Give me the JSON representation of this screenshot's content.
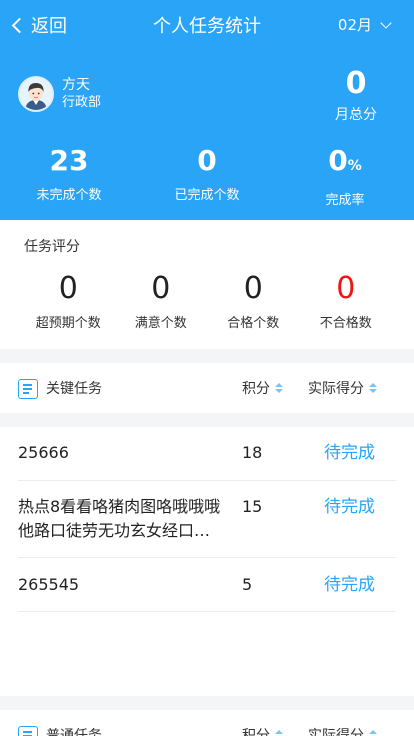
{
  "nav": {
    "back_label": "返回",
    "title": "个人任务统计",
    "month": "02月"
  },
  "profile": {
    "name": "方天",
    "department": "行政部"
  },
  "month_score": {
    "value": "0",
    "label": "月总分"
  },
  "stats": [
    {
      "value": "23",
      "unit": "",
      "label": "未完成个数"
    },
    {
      "value": "0",
      "unit": "",
      "label": "已完成个数"
    },
    {
      "value": "0",
      "unit": "%",
      "label": "完成率"
    }
  ],
  "evaluation": {
    "heading": "任务评分",
    "items": [
      {
        "value": "0",
        "label": "超预期个数"
      },
      {
        "value": "0",
        "label": "满意个数"
      },
      {
        "value": "0",
        "label": "合格个数"
      },
      {
        "value": "0",
        "label": "不合格数"
      }
    ]
  },
  "key_tasks": {
    "title": "关键任务",
    "col_score": "积分",
    "col_actual": "实际得分",
    "rows": [
      {
        "name_line1": "25666",
        "name_line2": "",
        "score": "18",
        "status": "待完成"
      },
      {
        "name_line1": "热点8看看咯猪肉图咯哦哦哦",
        "name_line2": "他路口徒劳无功玄女经口…",
        "score": "15",
        "status": "待完成"
      },
      {
        "name_line1": "265545",
        "name_line2": "",
        "score": "5",
        "status": "待完成"
      }
    ]
  },
  "normal_tasks": {
    "title": "普通任务",
    "col_score": "积分",
    "col_actual": "实际得分"
  },
  "colors": {
    "primary": "#2aa4f6",
    "danger": "#f01414"
  }
}
